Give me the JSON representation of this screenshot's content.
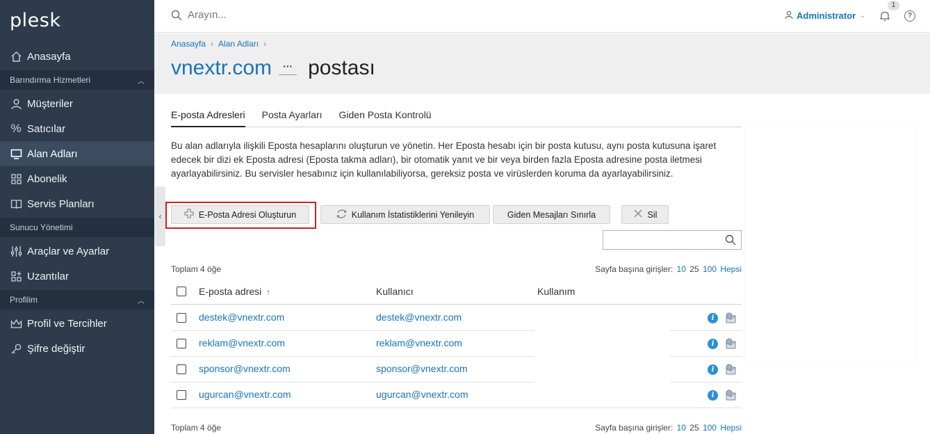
{
  "app": {
    "logo": "plesk"
  },
  "sidebar": {
    "home": "Anasayfa",
    "sections": [
      {
        "label": "Barındırma Hizmetleri"
      },
      {
        "label": "Sunucu Yönetimi"
      },
      {
        "label": "Profilim"
      }
    ],
    "items": {
      "customers": "Müşteriler",
      "resellers": "Satıcılar",
      "domains": "Alan Adları",
      "subscriptions": "Abonelik",
      "service_plans": "Servis Planları",
      "tools": "Araçlar ve Ayarlar",
      "extensions": "Uzantılar",
      "profile": "Profil ve Tercihler",
      "password": "Şifre değiştir"
    }
  },
  "topbar": {
    "search_placeholder": "Arayın...",
    "user": "Administrator",
    "notifications_count": "1",
    "help": "?"
  },
  "breadcrumb": [
    "Anasayfa",
    "Alan Adları"
  ],
  "page": {
    "title_domain": "vnextr.com",
    "title_more": "···",
    "title_rest": "postası"
  },
  "tabs": [
    "E-posta Adresleri",
    "Posta Ayarları",
    "Giden Posta Kontrolü"
  ],
  "description": "Bu alan adlarıyla ilişkili Eposta hesaplarını oluşturun ve yönetin. Her Eposta hesabı için bir posta kutusu, aynı posta kutusuna işaret edecek bir dizi ek Eposta adresi (Eposta takma adları), bir otomatik yanıt ve bir veya birden fazla Eposta adresine posta iletmesi ayarlayabilirsiniz. Bu servisler hesabınız için kullanılabiliyorsa, gereksiz posta ve virüslerden koruma da ayarlayabilirsiniz.",
  "toolbar": {
    "create": "E-Posta Adresi Oluşturun",
    "refresh": "Kullanım İstatistiklerini Yenileyin",
    "limit": "Giden Mesajları Sınırla",
    "delete": "Sil"
  },
  "list": {
    "total": "Toplam 4 öğe",
    "per_page_label": "Sayfa başına girişler:",
    "per_page_options": [
      "10",
      "25",
      "100",
      "Hepsi"
    ],
    "columns": {
      "email": "E-posta adresi",
      "sort_arrow": "↑",
      "user": "Kullanıcı",
      "usage": "Kullanım"
    },
    "rows": [
      {
        "email": "destek@vnextr.com",
        "user": "destek@vnextr.com"
      },
      {
        "email": "reklam@vnextr.com",
        "user": "reklam@vnextr.com"
      },
      {
        "email": "sponsor@vnextr.com",
        "user": "sponsor@vnextr.com"
      },
      {
        "email": "ugurcan@vnextr.com",
        "user": "ugurcan@vnextr.com"
      }
    ]
  },
  "colors": {
    "sidebar": "#2d3b4c",
    "accent": "#1874b9",
    "highlight": "#d0201a"
  }
}
